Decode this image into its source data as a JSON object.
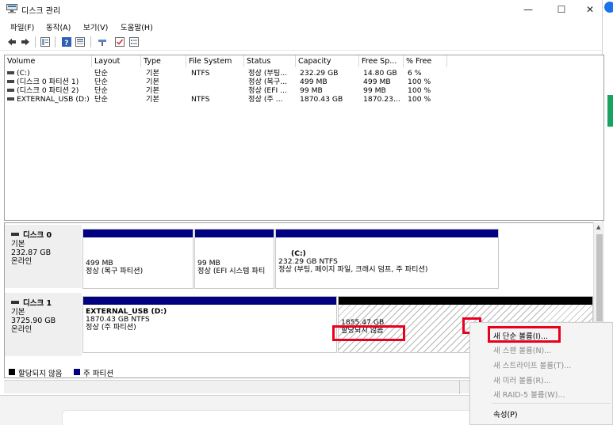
{
  "window": {
    "title": "디스크 관리",
    "minimize": "—",
    "maximize": "☐",
    "close": "✕"
  },
  "menu": [
    "파일(F)",
    "동작(A)",
    "보기(V)",
    "도움말(H)"
  ],
  "volume_table": {
    "columns": [
      "Volume",
      "Layout",
      "Type",
      "File System",
      "Status",
      "Capacity",
      "Free Sp...",
      "% Free"
    ],
    "rows": [
      [
        "(C:)",
        "단순",
        "기본",
        "NTFS",
        "정상 (부팅...",
        "232.29 GB",
        "14.80 GB",
        "6 %"
      ],
      [
        "(디스크 0 파티션 1)",
        "단순",
        "기본",
        "",
        "정상 (복구...",
        "499 MB",
        "499 MB",
        "100 %"
      ],
      [
        "(디스크 0 파티션 2)",
        "단순",
        "기본",
        "",
        "정상 (EFI ...",
        "99 MB",
        "99 MB",
        "100 %"
      ],
      [
        "EXTERNAL_USB (D:)",
        "단순",
        "기본",
        "NTFS",
        "정상 (주 ...",
        "1870.43 GB",
        "1870.23...",
        "100 %"
      ]
    ]
  },
  "disks": [
    {
      "name": "디스크 0",
      "type": "기본",
      "size": "232.87 GB",
      "state": "온라인",
      "partitions": [
        {
          "title": "",
          "size": "499 MB",
          "desc": "정상 (복구 파티션)"
        },
        {
          "title": "",
          "size": "99 MB",
          "desc": "정상 (EFI 시스템 파티"
        },
        {
          "title": "(C:)",
          "size": "232.29 GB NTFS",
          "desc": "정상 (부팅, 페이지 파일, 크래시 덤프, 주 파티션)"
        }
      ]
    },
    {
      "name": "디스크 1",
      "type": "기본",
      "size": "3725.90 GB",
      "state": "온라인",
      "partitions": [
        {
          "title": "EXTERNAL_USB  (D:)",
          "size": "1870.43 GB NTFS",
          "desc": "정상 (주 파티션)"
        },
        {
          "title": "",
          "size": "1855.47 GB",
          "desc": "할당되지 않음"
        }
      ]
    }
  ],
  "legend": {
    "unallocated": "할당되지 않음",
    "primary": "주 파티션",
    "unallocated_color": "#000000",
    "primary_color": "#000080"
  },
  "context_menu": {
    "items": [
      {
        "label": "새 단순 볼륨(I)...",
        "enabled": true
      },
      {
        "label": "새 스팬 볼륨(N)...",
        "enabled": false
      },
      {
        "label": "새 스트라이프 볼륨(T)...",
        "enabled": false
      },
      {
        "label": "새 미러 볼륨(R)...",
        "enabled": false
      },
      {
        "label": "새 RAID-5 볼륨(W)...",
        "enabled": false
      }
    ],
    "properties": "속성(P)"
  },
  "colors": {
    "highlight": "#e8001c",
    "primary_bar": "#000080",
    "unallocated_bar": "#000000"
  }
}
